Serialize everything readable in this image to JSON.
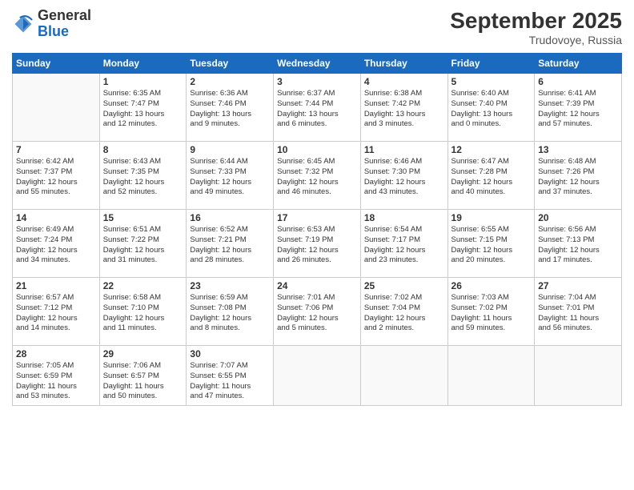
{
  "logo": {
    "general": "General",
    "blue": "Blue"
  },
  "header": {
    "month": "September 2025",
    "location": "Trudovoye, Russia"
  },
  "weekdays": [
    "Sunday",
    "Monday",
    "Tuesday",
    "Wednesday",
    "Thursday",
    "Friday",
    "Saturday"
  ],
  "weeks": [
    [
      {
        "day": "",
        "info": ""
      },
      {
        "day": "1",
        "info": "Sunrise: 6:35 AM\nSunset: 7:47 PM\nDaylight: 13 hours\nand 12 minutes."
      },
      {
        "day": "2",
        "info": "Sunrise: 6:36 AM\nSunset: 7:46 PM\nDaylight: 13 hours\nand 9 minutes."
      },
      {
        "day": "3",
        "info": "Sunrise: 6:37 AM\nSunset: 7:44 PM\nDaylight: 13 hours\nand 6 minutes."
      },
      {
        "day": "4",
        "info": "Sunrise: 6:38 AM\nSunset: 7:42 PM\nDaylight: 13 hours\nand 3 minutes."
      },
      {
        "day": "5",
        "info": "Sunrise: 6:40 AM\nSunset: 7:40 PM\nDaylight: 13 hours\nand 0 minutes."
      },
      {
        "day": "6",
        "info": "Sunrise: 6:41 AM\nSunset: 7:39 PM\nDaylight: 12 hours\nand 57 minutes."
      }
    ],
    [
      {
        "day": "7",
        "info": "Sunrise: 6:42 AM\nSunset: 7:37 PM\nDaylight: 12 hours\nand 55 minutes."
      },
      {
        "day": "8",
        "info": "Sunrise: 6:43 AM\nSunset: 7:35 PM\nDaylight: 12 hours\nand 52 minutes."
      },
      {
        "day": "9",
        "info": "Sunrise: 6:44 AM\nSunset: 7:33 PM\nDaylight: 12 hours\nand 49 minutes."
      },
      {
        "day": "10",
        "info": "Sunrise: 6:45 AM\nSunset: 7:32 PM\nDaylight: 12 hours\nand 46 minutes."
      },
      {
        "day": "11",
        "info": "Sunrise: 6:46 AM\nSunset: 7:30 PM\nDaylight: 12 hours\nand 43 minutes."
      },
      {
        "day": "12",
        "info": "Sunrise: 6:47 AM\nSunset: 7:28 PM\nDaylight: 12 hours\nand 40 minutes."
      },
      {
        "day": "13",
        "info": "Sunrise: 6:48 AM\nSunset: 7:26 PM\nDaylight: 12 hours\nand 37 minutes."
      }
    ],
    [
      {
        "day": "14",
        "info": "Sunrise: 6:49 AM\nSunset: 7:24 PM\nDaylight: 12 hours\nand 34 minutes."
      },
      {
        "day": "15",
        "info": "Sunrise: 6:51 AM\nSunset: 7:22 PM\nDaylight: 12 hours\nand 31 minutes."
      },
      {
        "day": "16",
        "info": "Sunrise: 6:52 AM\nSunset: 7:21 PM\nDaylight: 12 hours\nand 28 minutes."
      },
      {
        "day": "17",
        "info": "Sunrise: 6:53 AM\nSunset: 7:19 PM\nDaylight: 12 hours\nand 26 minutes."
      },
      {
        "day": "18",
        "info": "Sunrise: 6:54 AM\nSunset: 7:17 PM\nDaylight: 12 hours\nand 23 minutes."
      },
      {
        "day": "19",
        "info": "Sunrise: 6:55 AM\nSunset: 7:15 PM\nDaylight: 12 hours\nand 20 minutes."
      },
      {
        "day": "20",
        "info": "Sunrise: 6:56 AM\nSunset: 7:13 PM\nDaylight: 12 hours\nand 17 minutes."
      }
    ],
    [
      {
        "day": "21",
        "info": "Sunrise: 6:57 AM\nSunset: 7:12 PM\nDaylight: 12 hours\nand 14 minutes."
      },
      {
        "day": "22",
        "info": "Sunrise: 6:58 AM\nSunset: 7:10 PM\nDaylight: 12 hours\nand 11 minutes."
      },
      {
        "day": "23",
        "info": "Sunrise: 6:59 AM\nSunset: 7:08 PM\nDaylight: 12 hours\nand 8 minutes."
      },
      {
        "day": "24",
        "info": "Sunrise: 7:01 AM\nSunset: 7:06 PM\nDaylight: 12 hours\nand 5 minutes."
      },
      {
        "day": "25",
        "info": "Sunrise: 7:02 AM\nSunset: 7:04 PM\nDaylight: 12 hours\nand 2 minutes."
      },
      {
        "day": "26",
        "info": "Sunrise: 7:03 AM\nSunset: 7:02 PM\nDaylight: 11 hours\nand 59 minutes."
      },
      {
        "day": "27",
        "info": "Sunrise: 7:04 AM\nSunset: 7:01 PM\nDaylight: 11 hours\nand 56 minutes."
      }
    ],
    [
      {
        "day": "28",
        "info": "Sunrise: 7:05 AM\nSunset: 6:59 PM\nDaylight: 11 hours\nand 53 minutes."
      },
      {
        "day": "29",
        "info": "Sunrise: 7:06 AM\nSunset: 6:57 PM\nDaylight: 11 hours\nand 50 minutes."
      },
      {
        "day": "30",
        "info": "Sunrise: 7:07 AM\nSunset: 6:55 PM\nDaylight: 11 hours\nand 47 minutes."
      },
      {
        "day": "",
        "info": ""
      },
      {
        "day": "",
        "info": ""
      },
      {
        "day": "",
        "info": ""
      },
      {
        "day": "",
        "info": ""
      }
    ]
  ]
}
